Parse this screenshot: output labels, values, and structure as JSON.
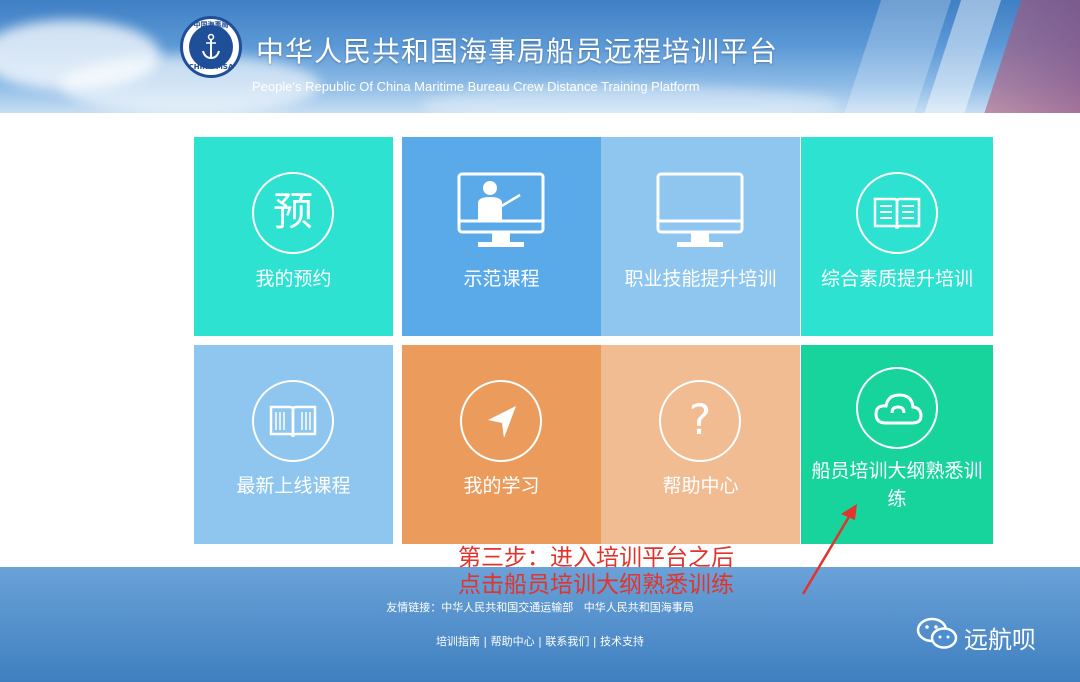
{
  "header": {
    "title_cn": "中华人民共和国海事局船员远程培训平台",
    "title_en": "People's Republic Of China Maritime Bureau Crew Distance Training Platform",
    "logo_top": "中国海事局",
    "logo_bottom": "CHINA MSA"
  },
  "tiles": [
    {
      "label": "我的预约",
      "icon": "yu-character-icon",
      "color": "#2ee2d2"
    },
    {
      "label": "示范课程",
      "icon": "teacher-screen-icon",
      "color": "#5aaaea"
    },
    {
      "label": "职业技能提升培训",
      "icon": "monitor-icon",
      "color": "#8ec6f0"
    },
    {
      "label": "综合素质提升培训",
      "icon": "open-book-icon",
      "color": "#2ee2d2"
    },
    {
      "label": "最新上线课程",
      "icon": "book-circle-icon",
      "color": "#8ec6f0"
    },
    {
      "label": "我的学习",
      "icon": "navigation-arrow-icon",
      "color": "#eb9c5c"
    },
    {
      "label": "帮助中心",
      "icon": "question-mark-icon",
      "color": "#f2bc93"
    },
    {
      "label": "船员培训大纲熟悉训练",
      "icon": "cloud-icon",
      "color": "#17d49d"
    }
  ],
  "yu_char": "预",
  "question_char": "?",
  "annotation": {
    "line1": "第三步：进入培训平台之后",
    "line2": "点击船员培训大纲熟悉训练"
  },
  "footer": {
    "links_prefix": "友情链接：",
    "link1": "中华人民共和国交通运输部",
    "link2": "中华人民共和国海事局",
    "bottom_links": [
      "培训指南",
      "帮助中心",
      "联系我们",
      "技术支持"
    ],
    "separator": " | "
  },
  "watermark": {
    "text": "远航呗",
    "icon": "wechat-icon"
  }
}
